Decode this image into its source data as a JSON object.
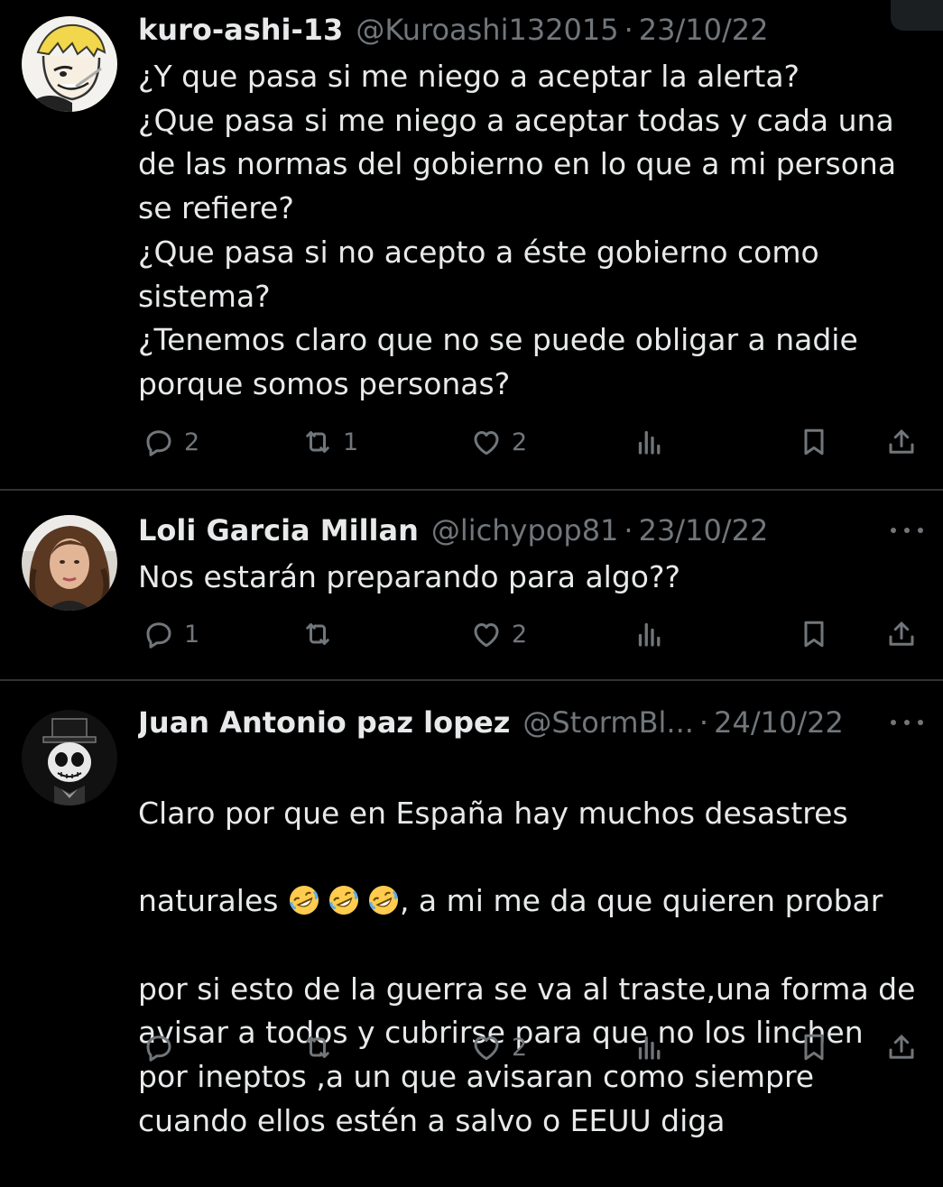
{
  "accent": {
    "muted": "#71767b",
    "text": "#e7e9ea",
    "divider": "#2f3336"
  },
  "tweets": [
    {
      "name": "kuro-ashi-13",
      "handle": "@Kuroashi132015",
      "dot": "·",
      "date": "23/10/22",
      "text": "¿Y que pasa si me niego a aceptar la alerta?\n¿Que pasa si me niego a aceptar todas y cada una\nde las normas del gobierno en lo que a mi persona\nse refiere?\n¿Que pasa si no acepto a éste gobierno como\nsistema?\n¿Tenemos claro que no se puede obligar a nadie\nporque somos personas?",
      "replies": "2",
      "retweets": "1",
      "likes": "2",
      "avatar_icon": "cartoon-avatar-icon"
    },
    {
      "name": "Loli Garcia Millan",
      "handle": "@lichypop81",
      "dot": "·",
      "date": "23/10/22",
      "text": "Nos estarán preparando para algo??",
      "replies": "1",
      "retweets": "",
      "likes": "2",
      "avatar_icon": "photo-avatar-icon"
    },
    {
      "name": "Juan Antonio paz lopez",
      "handle": "@StormBl...",
      "dot": "·",
      "date": "24/10/22",
      "text_line1": "Claro por que en España hay muchos desastres",
      "text_line2_start": "naturales",
      "text_line2_end": ", a mi me da que quieren probar",
      "text_rest": "por si esto de la guerra se va al traste,una forma de\navisar a todos y cubrirse para que no los linchen\npor ineptos ,a un que avisaran como siempre\ncuando ellos estén a salvo o EEUU diga",
      "emoji": "rolling-on-floor-laughing-emoji",
      "replies": "",
      "retweets": "",
      "likes": "2",
      "avatar_icon": "skull-avatar-icon"
    }
  ]
}
